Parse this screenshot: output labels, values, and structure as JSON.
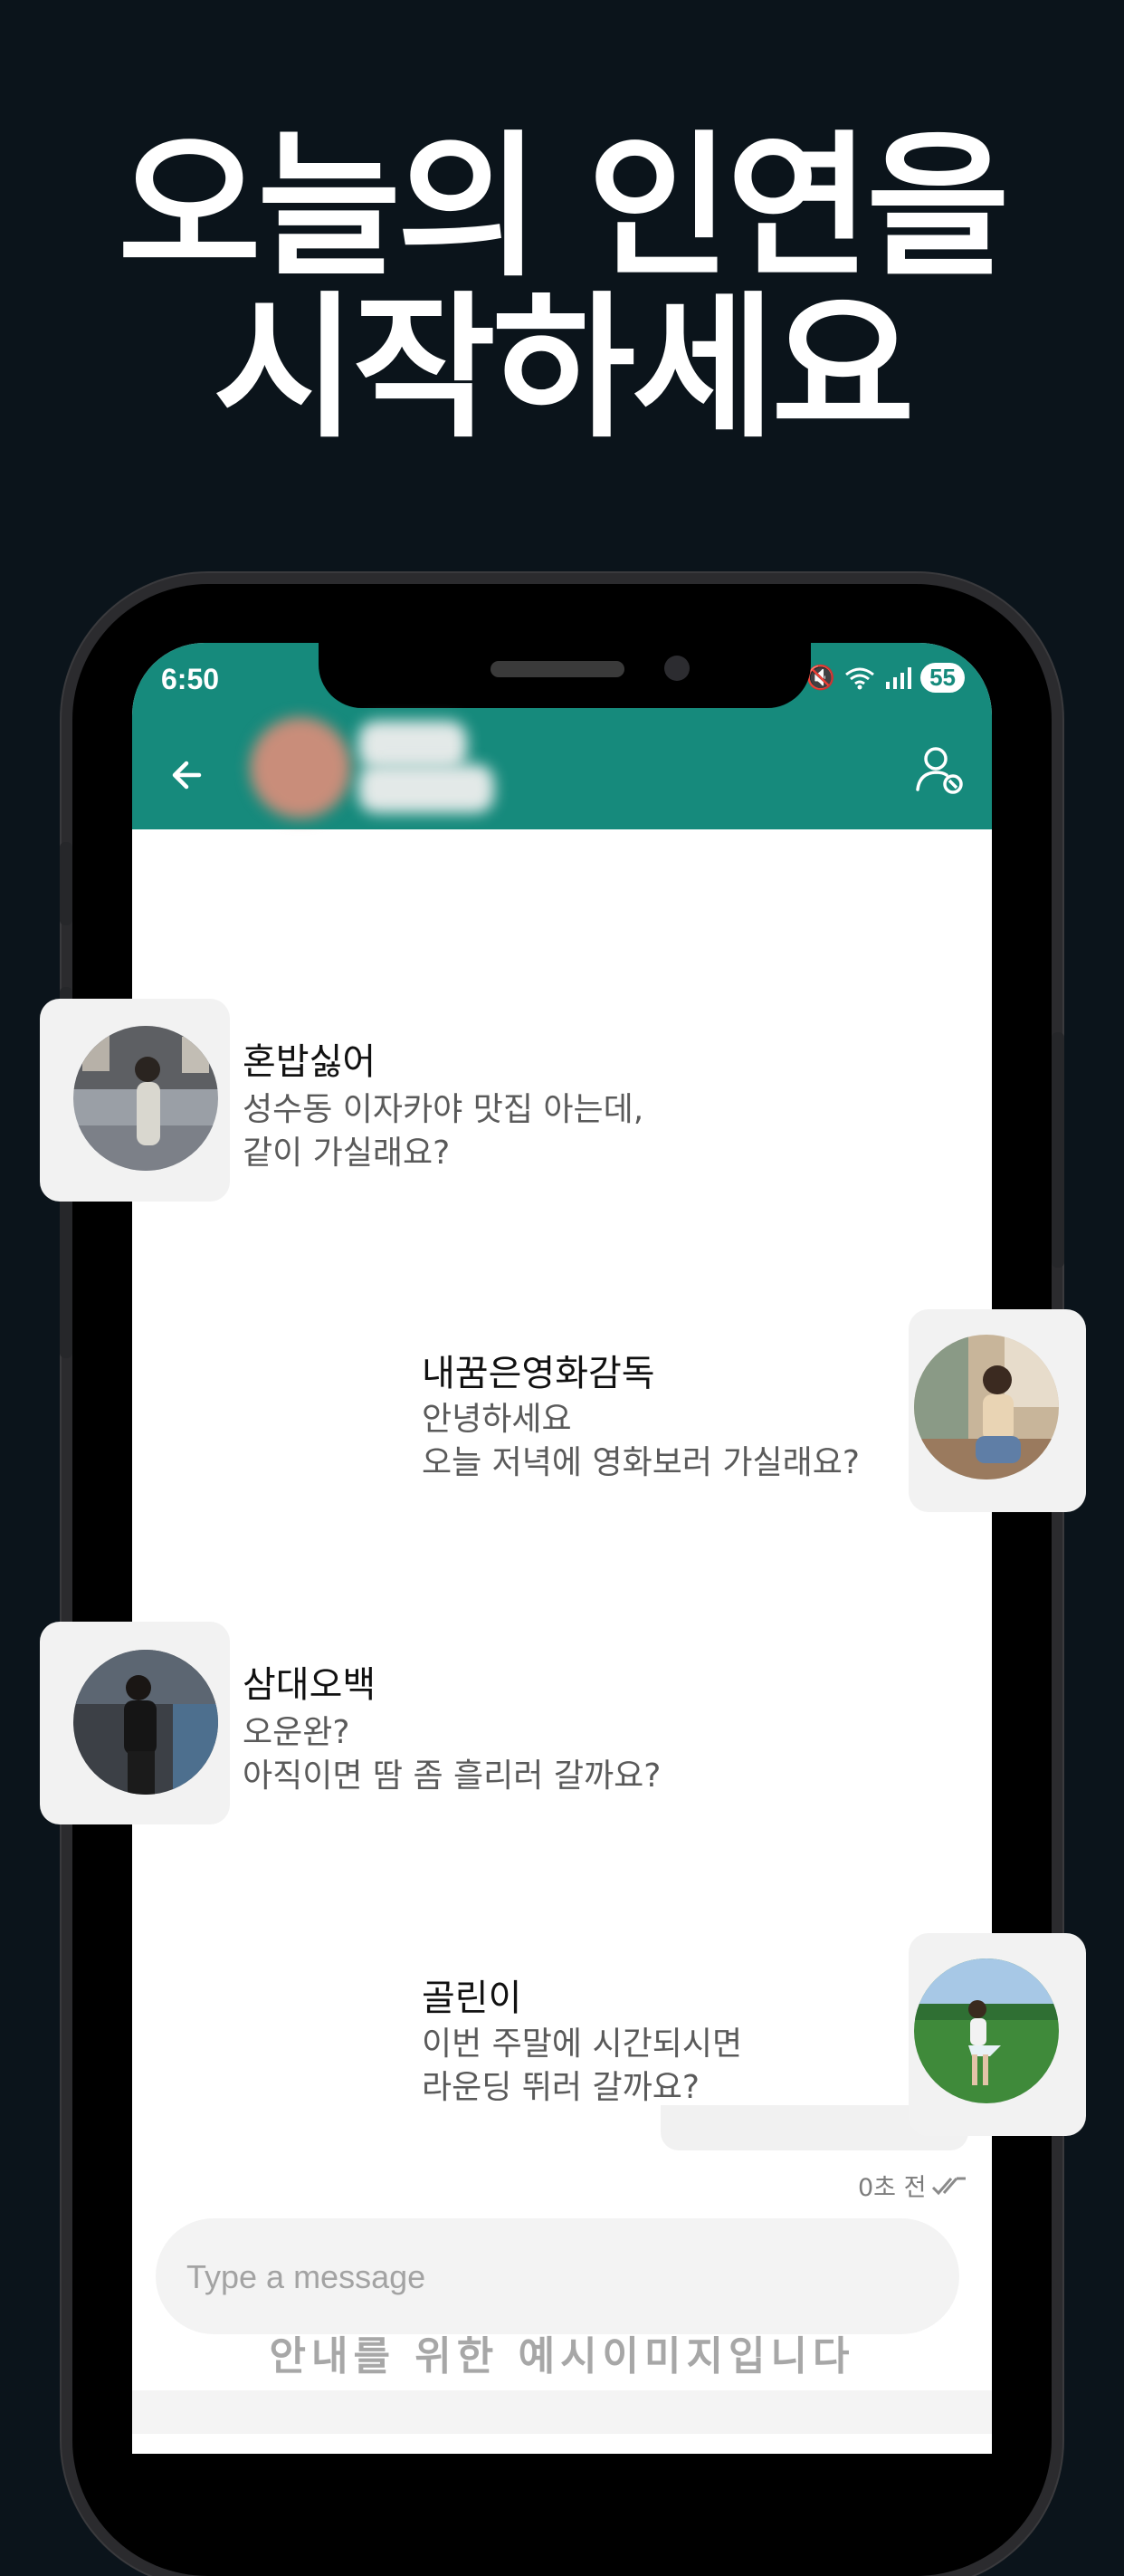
{
  "headline": {
    "line1": "오늘의 인연을",
    "line2": "시작하세요"
  },
  "status_bar": {
    "time": "6:50",
    "battery": "55"
  },
  "messages": [
    {
      "name": "혼밥싫어",
      "lines": [
        "성수동 이자카야 맛집 아는데,",
        "같이 가실래요?"
      ]
    },
    {
      "name": "내꿈은영화감독",
      "lines": [
        "안녕하세요",
        "오늘 저녁에 영화보러 가실래요?"
      ]
    },
    {
      "name": "삼대오백",
      "lines": [
        "오운완?",
        "아직이면 땀 좀 흘리러 갈까요?"
      ]
    },
    {
      "name": "골린이",
      "lines": [
        "이번 주말에 시간되시면",
        "라운딩 뛰러 갈까요?"
      ]
    }
  ],
  "message_meta": {
    "time": "0초 전"
  },
  "input": {
    "placeholder": "Type a message"
  },
  "watermark": "안내를 위한 예시이미지입니다",
  "colors": {
    "appbar": "#168a7c",
    "background": "#0b141b"
  }
}
